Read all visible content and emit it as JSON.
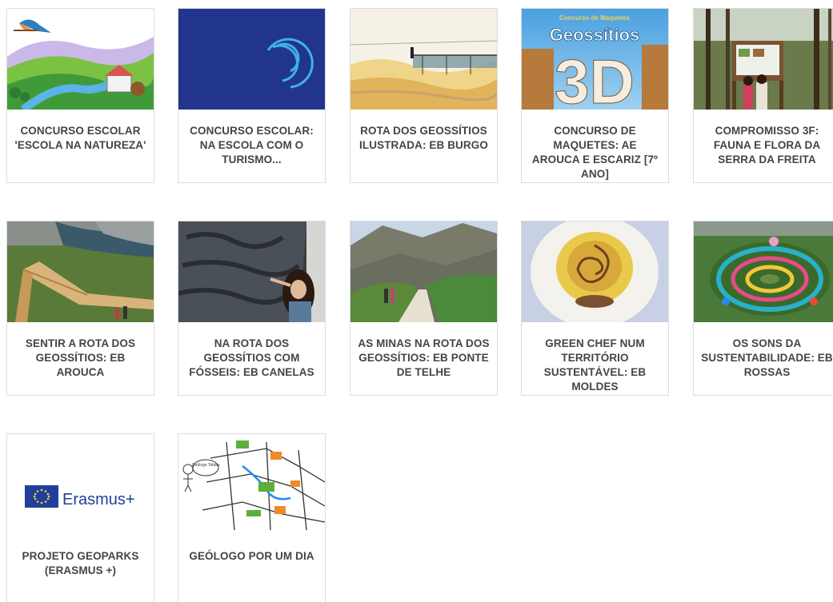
{
  "cards": [
    {
      "title": "CONCURSO ESCOLAR 'ESCOLA NA NATUREZA'",
      "image": "kingfisher-landscape-illustration"
    },
    {
      "title": "CONCURSO ESCOLAR: NA ESCOLA COM O TURISMO...",
      "image": "blue-logo-arcs"
    },
    {
      "title": "ROTA DOS GEOSSÍTIOS ILUSTRADA: EB BURGO",
      "image": "walkway-illustration"
    },
    {
      "title": "CONCURSO DE MAQUETES: AE AROUCA E ESCARIZ [7º ANO]",
      "image": "geossitios-3d-poster",
      "image_text": {
        "top": "Concurso de Maquetes",
        "mid": "Geossítios",
        "big": "3D"
      }
    },
    {
      "title": "COMPROMISSO 3F: FAUNA E FLORA DA SERRA DA FREITA",
      "image": "forest-sign-photo"
    },
    {
      "title": "SENTIR A ROTA DOS GEOSSÍTIOS: EB AROUCA",
      "image": "wooden-walkway-river-photo"
    },
    {
      "title": "NA ROTA DOS GEOSSÍTIOS COM FÓSSEIS: EB CANELAS",
      "image": "fossil-wall-photo"
    },
    {
      "title": "AS MINAS NA ROTA DOS GEOSSÍTIOS: EB PONTE DE TELHE",
      "image": "mountain-path-photo"
    },
    {
      "title": "GREEN CHEF NUM TERRITÓRIO SUSTENTÁVEL: EB MOLDES",
      "image": "rose-dish-photo"
    },
    {
      "title": "OS SONS DA SUSTENTABILIDADE: EB ROSSAS",
      "image": "children-circle-photo"
    },
    {
      "title": "PROJETO GEOPARKS (ERASMUS +)",
      "image": "erasmus-plus-logo",
      "image_text": {
        "logo": "Erasmus+"
      }
    },
    {
      "title": "GEÓLOGO POR UM DIA",
      "image": "hand-drawn-map",
      "image_text": {
        "bubble": "Geólogo Tobias"
      }
    }
  ]
}
